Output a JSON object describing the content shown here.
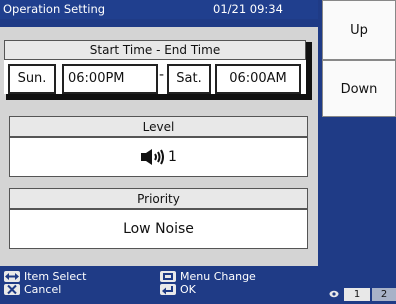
{
  "header": {
    "title": "Operation Setting",
    "datetime": "01/21 09:34"
  },
  "schedule": {
    "heading": "Start Time - End Time",
    "start_day": "Sun.",
    "start_time": "06:00PM",
    "separator": "-",
    "end_day": "Sat.",
    "end_time": "06:00AM"
  },
  "level": {
    "heading": "Level",
    "value": "1",
    "icon": "speaker-volume-icon"
  },
  "priority": {
    "heading": "Priority",
    "value": "Low Noise"
  },
  "side": {
    "up_label": "Up",
    "down_label": "Down"
  },
  "footer": {
    "item_select": "Item Select",
    "cancel": "Cancel",
    "menu_change": "Menu Change",
    "ok": "OK"
  },
  "pager": {
    "pages": [
      "1",
      "2"
    ],
    "current": "1"
  }
}
